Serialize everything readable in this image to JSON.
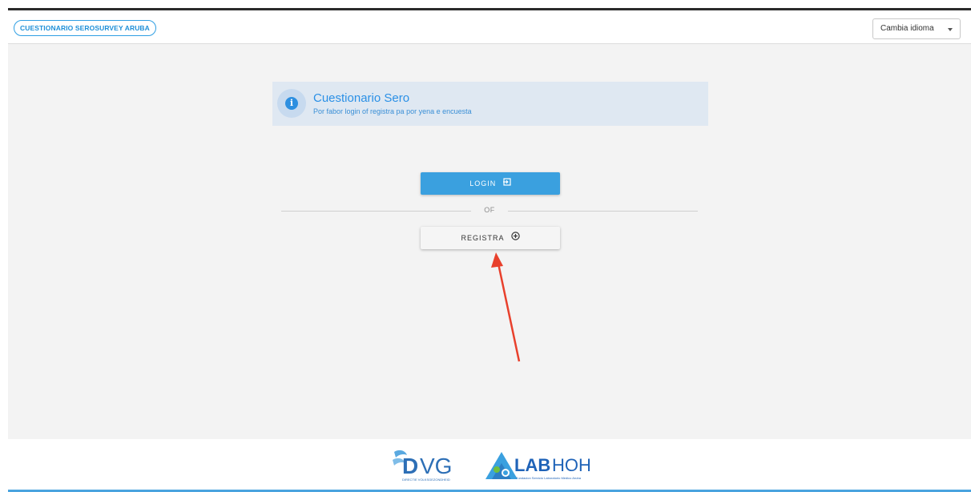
{
  "header": {
    "survey_badge": "CUESTIONARIO SEROSURVEY ARUBA",
    "language_select": {
      "selected": "Cambia idioma"
    }
  },
  "alert": {
    "title": "Cuestionario Sero",
    "message": "Por fabor login of registra pa por yena e encuesta",
    "icon": "info-icon"
  },
  "actions": {
    "login_label": "LOGIN",
    "separator": "OF",
    "register_label": "REGISTRA"
  },
  "footer": {
    "logos": [
      "DVG",
      "LABHOH"
    ],
    "dvg_caption": "DIRECTIE VOLKSGEZONDHEID",
    "labhoh_caption": "Fundacion Servicio Laboratorio Medico Aruba"
  },
  "annotation": {
    "arrow_color": "#e8402c"
  },
  "colors": {
    "accent": "#3aa0df",
    "alert_bg": "#dfe8f2"
  }
}
